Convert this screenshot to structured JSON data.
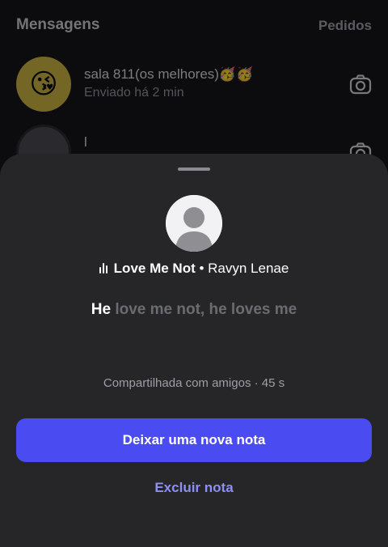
{
  "background": {
    "header": {
      "title": "Mensagens",
      "requests_label": "Pedidos"
    },
    "chats": [
      {
        "name": "sala 811(os melhores)🥳🥳",
        "subtitle": "Enviado há 2 min",
        "avatar_emoji": "😘",
        "icon": "camera-icon"
      },
      {
        "name": "l",
        "subtitle": "",
        "avatar_emoji": "",
        "icon": "camera-icon"
      }
    ]
  },
  "sheet": {
    "song_title": "Love Me Not",
    "separator": " • ",
    "artist": "Ravyn Lenae",
    "lyric_active": "He",
    "lyric_rest": "love me not, he loves me",
    "shared_text": "Compartilhada com amigos · 45 s",
    "primary_button_label": "Deixar uma nova nota",
    "secondary_button_label": "Excluir nota",
    "icons": {
      "music": "music-bars-icon",
      "avatar": "default-avatar-icon"
    }
  },
  "colors": {
    "sheet_bg": "#262629",
    "primary_button": "#4a4cf2",
    "link": "#8e8ff5",
    "lyric_dim": "#6b6b72"
  }
}
